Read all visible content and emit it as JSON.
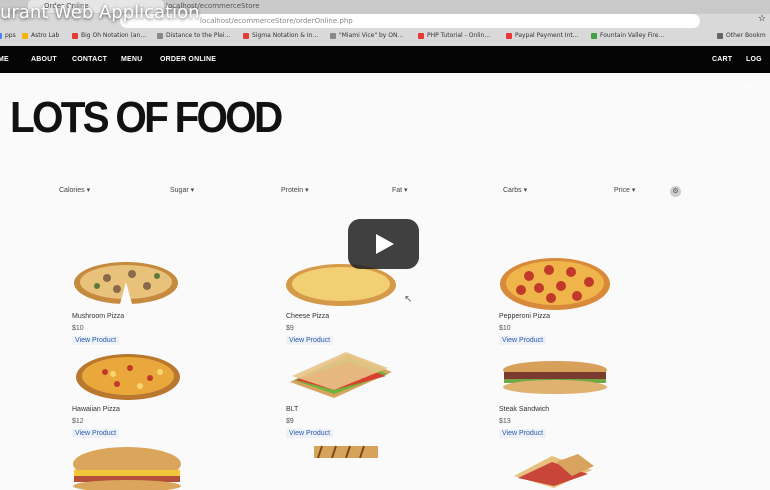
{
  "video": {
    "title": "urant Web Application"
  },
  "browser": {
    "tabs": [
      {
        "label": "Order Online"
      },
      {
        "label": "localhost/ecommerceStore"
      }
    ],
    "url": "localhost/ecommerceStore/orderOnline.php",
    "bookmarks": [
      {
        "label": "pps",
        "color": "#4285f4"
      },
      {
        "label": "Astro Lab",
        "color": "#f4b400"
      },
      {
        "label": "Big Oh Notation (an...",
        "color": "#e53935"
      },
      {
        "label": "Distance to the Plei...",
        "color": "#888888"
      },
      {
        "label": "Sigma Notation & In...",
        "color": "#e53935"
      },
      {
        "label": "\"Miami Vice\" by ON...",
        "color": "#888888"
      },
      {
        "label": "PHP Tutorial - Onlin...",
        "color": "#e53935"
      },
      {
        "label": "Paypal Payment Int...",
        "color": "#e53935"
      },
      {
        "label": "Fountain Valley Fire...",
        "color": "#43a047"
      },
      {
        "label": "Other Bookm",
        "color": "#666666"
      }
    ]
  },
  "nav": {
    "home": "ME",
    "about": "ABOUT",
    "contact": "CONTACT",
    "menu": "MENU",
    "order": "ORDER ONLINE",
    "cart": "CART",
    "login": "LOG IN"
  },
  "hero": {
    "title": "LOTS OF FOOD"
  },
  "filters": [
    {
      "label": "Calories ▾"
    },
    {
      "label": "Sugar ▾"
    },
    {
      "label": "Protein ▾"
    },
    {
      "label": "Fat ▾"
    },
    {
      "label": "Carbs ▾"
    },
    {
      "label": "Price ▾"
    }
  ],
  "products": [
    {
      "name": "Mushroom Pizza",
      "price": "$10",
      "button": "View Product"
    },
    {
      "name": "Cheese Pizza",
      "price": "$9",
      "button": "View Product"
    },
    {
      "name": "Pepperoni Pizza",
      "price": "$10",
      "button": "View Product"
    },
    {
      "name": "Hawaiian Pizza",
      "price": "$12",
      "button": "View Product"
    },
    {
      "name": "BLT",
      "price": "$9",
      "button": "View Product"
    },
    {
      "name": "Steak Sandwich",
      "price": "$13",
      "button": "View Product"
    }
  ]
}
